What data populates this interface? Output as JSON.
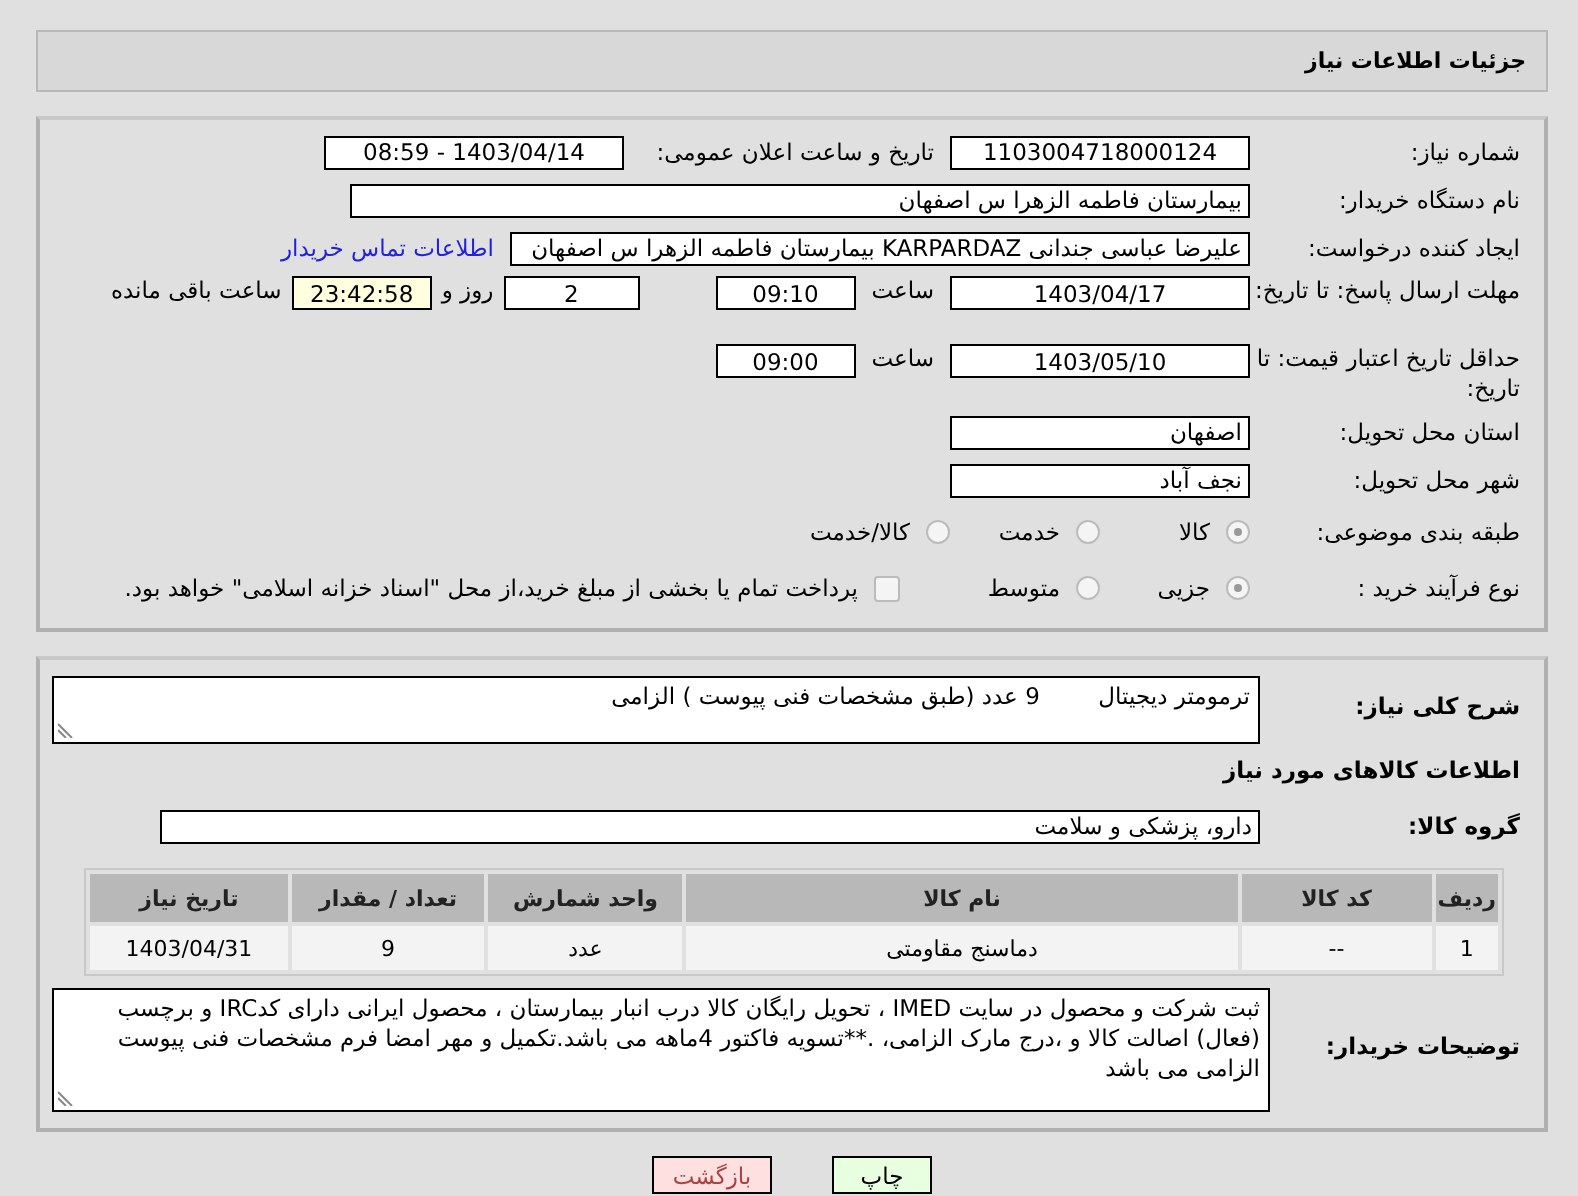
{
  "header": {
    "title": "جزئیات اطلاعات نیاز"
  },
  "need_number": {
    "label": "شماره نیاز:",
    "value": "1103004718000124"
  },
  "announce": {
    "label": "تاریخ و ساعت اعلان عمومی:",
    "value": "1403/04/14 - 08:59"
  },
  "buyer": {
    "label": "نام دستگاه خریدار:",
    "value": "بیمارستان فاطمه الزهرا س  اصفهان"
  },
  "creator": {
    "label": "ایجاد کننده درخواست:",
    "value": "علیرضا عباسی جندانی KARPARDAZ بیمارستان فاطمه الزهرا س  اصفهان",
    "link": "اطلاعات تماس خریدار"
  },
  "reply_deadline": {
    "label": "مهلت ارسال پاسخ: تا تاریخ:",
    "date": "1403/04/17",
    "time_label": "ساعت",
    "time": "09:10",
    "days": "2",
    "days_label": "روز و",
    "remaining": "23:42:58",
    "remaining_label": "ساعت باقی مانده"
  },
  "price_validity": {
    "label": "حداقل تاریخ اعتبار قیمت: تا تاریخ:",
    "date": "1403/05/10",
    "time_label": "ساعت",
    "time": "09:00"
  },
  "province": {
    "label": "استان محل تحویل:",
    "value": "اصفهان"
  },
  "city": {
    "label": "شهر محل تحویل:",
    "value": "نجف آباد"
  },
  "category": {
    "label": "طبقه بندی موضوعی:",
    "options": [
      {
        "label": "کالا",
        "selected": true
      },
      {
        "label": "خدمت",
        "selected": false
      },
      {
        "label": "کالا/خدمت",
        "selected": false
      }
    ]
  },
  "process": {
    "label": "نوع فرآیند خرید :",
    "options": [
      {
        "label": "جزیی",
        "selected": true
      },
      {
        "label": "متوسط",
        "selected": false
      }
    ],
    "payment": {
      "label": "پرداخت تمام یا بخشی از مبلغ خرید،از محل \"اسناد خزانه اسلامی\" خواهد بود.",
      "checked": false
    }
  },
  "description": {
    "label": "شرح کلی نیاز:",
    "value": "ترمومتر دیجیتال        9 عدد (طبق مشخصات فنی پیوست ) الزامی"
  },
  "items_title": "اطلاعات کالاهای مورد نیاز",
  "goods_group": {
    "label": "گروه کالا:",
    "value": "دارو، پزشکی و سلامت"
  },
  "table": {
    "columns": [
      "ردیف",
      "کد کالا",
      "نام کالا",
      "واحد شمارش",
      "تعداد / مقدار",
      "تاریخ نیاز"
    ],
    "rows": [
      [
        "1",
        "--",
        "دماسنج مقاومتی",
        "عدد",
        "9",
        "1403/04/31"
      ]
    ]
  },
  "buyer_notes": {
    "label": "توضیحات خریدار:",
    "value": "ثبت شرکت و محصول در سایت IMED ، تحویل رایگان کالا درب انبار بیمارستان ، محصول ایرانی دارای کدIRC و برچسب (فعال) اصالت کالا و ،درج مارک الزامی، .**تسویه فاکتور 4ماهه می باشد.تکمیل و مهر امضا فرم مشخصات فنی پیوست الزامی می باشد"
  },
  "buttons": [
    {
      "label": "چاپ",
      "kind": "print"
    },
    {
      "label": "بازگشت",
      "kind": "back"
    }
  ]
}
